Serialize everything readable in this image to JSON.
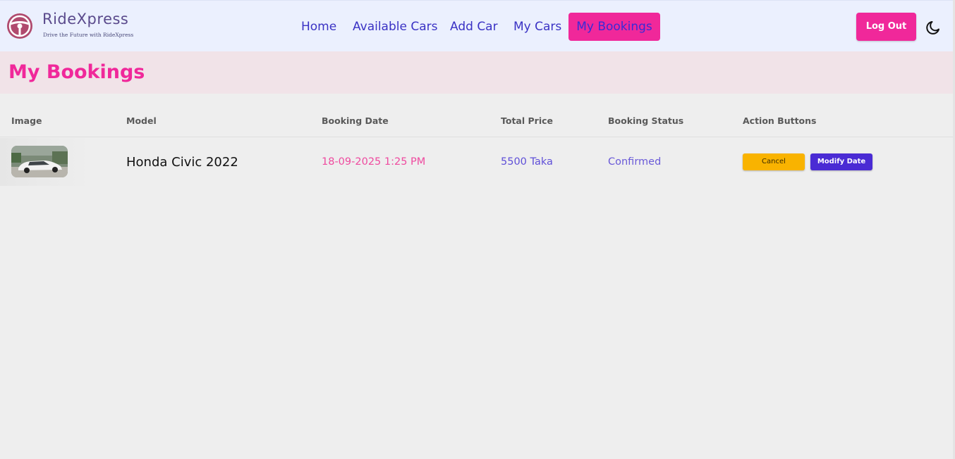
{
  "brand": {
    "name": "RideXpress",
    "tagline": "Drive the Future with RideXpress",
    "logo_icon": "steering-wheel-icon",
    "accent_color": "#f0289a",
    "primary_color": "#3a32c4"
  },
  "nav": {
    "links": [
      {
        "label": "Home"
      },
      {
        "label": "Available Cars"
      },
      {
        "label": "Add Car"
      },
      {
        "label": "My Cars"
      },
      {
        "label": "My Bookings",
        "active": true
      }
    ],
    "logout_label": "Log Out",
    "theme_icon": "moon-icon"
  },
  "page": {
    "title": "My Bookings"
  },
  "table": {
    "headers": [
      "Image",
      "Model",
      "Booking Date",
      "Total Price",
      "Booking Status",
      "Action Buttons"
    ],
    "rows": [
      {
        "image": "car-thumbnail",
        "model": "Honda Civic 2022",
        "booking_date": "18-09-2025 1:25 PM",
        "total_price": "5500 Taka",
        "status": "Confirmed",
        "actions": {
          "cancel": "Cancel",
          "modify": "Modify Date"
        }
      }
    ]
  }
}
